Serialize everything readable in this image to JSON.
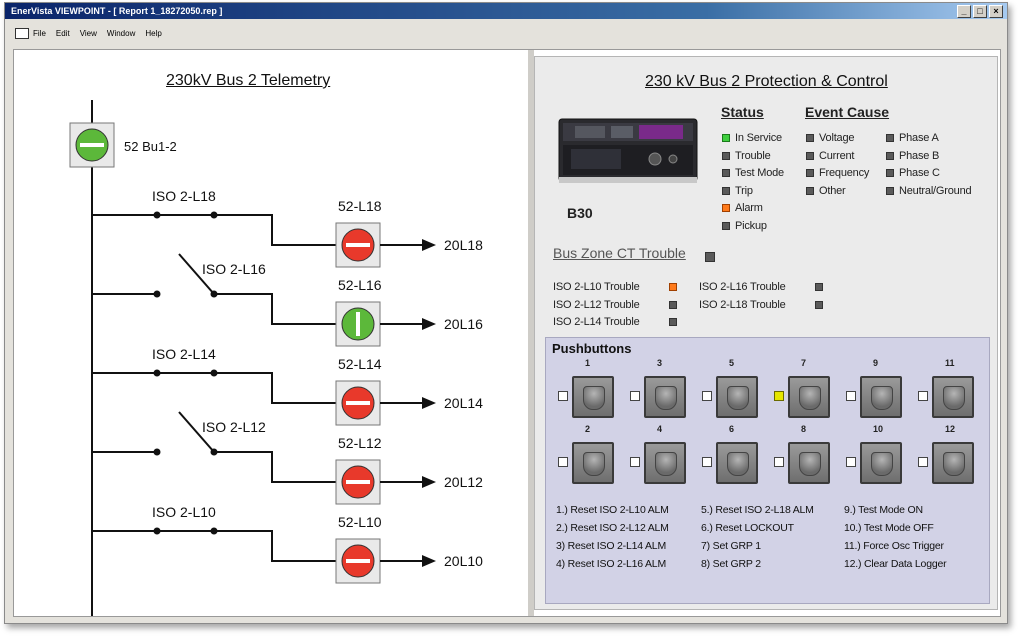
{
  "window": {
    "title": "EnerVista VIEWPOINT - [ Report 1_18272050.rep ]",
    "controls": [
      "_",
      "□",
      "×"
    ]
  },
  "menu": [
    "File",
    "Edit",
    "View",
    "Window",
    "Help"
  ],
  "left": {
    "title": "230kV Bus 2 Telemetry",
    "main_breaker": "52 Bu1-2",
    "feeders": [
      {
        "iso": "ISO 2-L18",
        "breaker": "52-L18",
        "line": "20L18",
        "iso_state": "closed",
        "breaker_state": "open"
      },
      {
        "iso": "ISO 2-L16",
        "breaker": "52-L16",
        "line": "20L16",
        "iso_state": "open",
        "breaker_state": "closed"
      },
      {
        "iso": "ISO 2-L14",
        "breaker": "52-L14",
        "line": "20L14",
        "iso_state": "closed",
        "breaker_state": "open"
      },
      {
        "iso": "ISO 2-L12",
        "breaker": "52-L12",
        "line": "20L12",
        "iso_state": "open",
        "breaker_state": "open"
      },
      {
        "iso": "ISO 2-L10",
        "breaker": "52-L10",
        "line": "20L10",
        "iso_state": "closed",
        "breaker_state": "open"
      }
    ],
    "colors": {
      "open": "#e8392b",
      "closed": "#5cb83a"
    }
  },
  "right": {
    "title": "230 kV Bus 2 Protection & Control",
    "device_label": "B30",
    "status_header": "Status",
    "status": [
      {
        "label": "In Service",
        "color": "green"
      },
      {
        "label": "Trouble",
        "color": "gray"
      },
      {
        "label": "Test Mode",
        "color": "gray"
      },
      {
        "label": "Trip",
        "color": "gray"
      },
      {
        "label": "Alarm",
        "color": "orange"
      },
      {
        "label": "Pickup",
        "color": "gray"
      }
    ],
    "event_header": "Event Cause",
    "event_col1": [
      "Voltage",
      "Current",
      "Frequency",
      "Other"
    ],
    "event_col2": [
      "Phase A",
      "Phase B",
      "Phase C",
      "Neutral/Ground"
    ],
    "bus_zone": "Bus Zone CT Trouble",
    "ct_col1": [
      {
        "label": "ISO 2-L10 Trouble",
        "color": "orange"
      },
      {
        "label": "ISO 2-L12 Trouble",
        "color": "gray"
      },
      {
        "label": "ISO 2-L14 Trouble",
        "color": "gray"
      }
    ],
    "ct_col2": [
      {
        "label": "ISO 2-L16 Trouble",
        "color": "gray"
      },
      {
        "label": "ISO 2-L18 Trouble",
        "color": "gray"
      }
    ],
    "pushbuttons_title": "Pushbuttons",
    "pb_row1": [
      "1",
      "3",
      "5",
      "7",
      "9",
      "11"
    ],
    "pb_row2": [
      "2",
      "4",
      "6",
      "8",
      "10",
      "12"
    ],
    "pb_checked": [
      "7"
    ],
    "legend_col1": [
      "1.) Reset ISO 2-L10 ALM",
      "2.) Reset ISO 2-L12 ALM",
      "3) Reset ISO 2-L14 ALM",
      "4) Reset ISO 2-L16 ALM"
    ],
    "legend_col2": [
      "5.) Reset ISO 2-L18 ALM",
      "6.) Reset LOCKOUT",
      "7) Set GRP 1",
      "8) Set GRP 2"
    ],
    "legend_col3": [
      "9.) Test Mode ON",
      "10.) Test Mode OFF",
      "11.) Force Osc Trigger",
      "12.) Clear Data Logger"
    ]
  }
}
